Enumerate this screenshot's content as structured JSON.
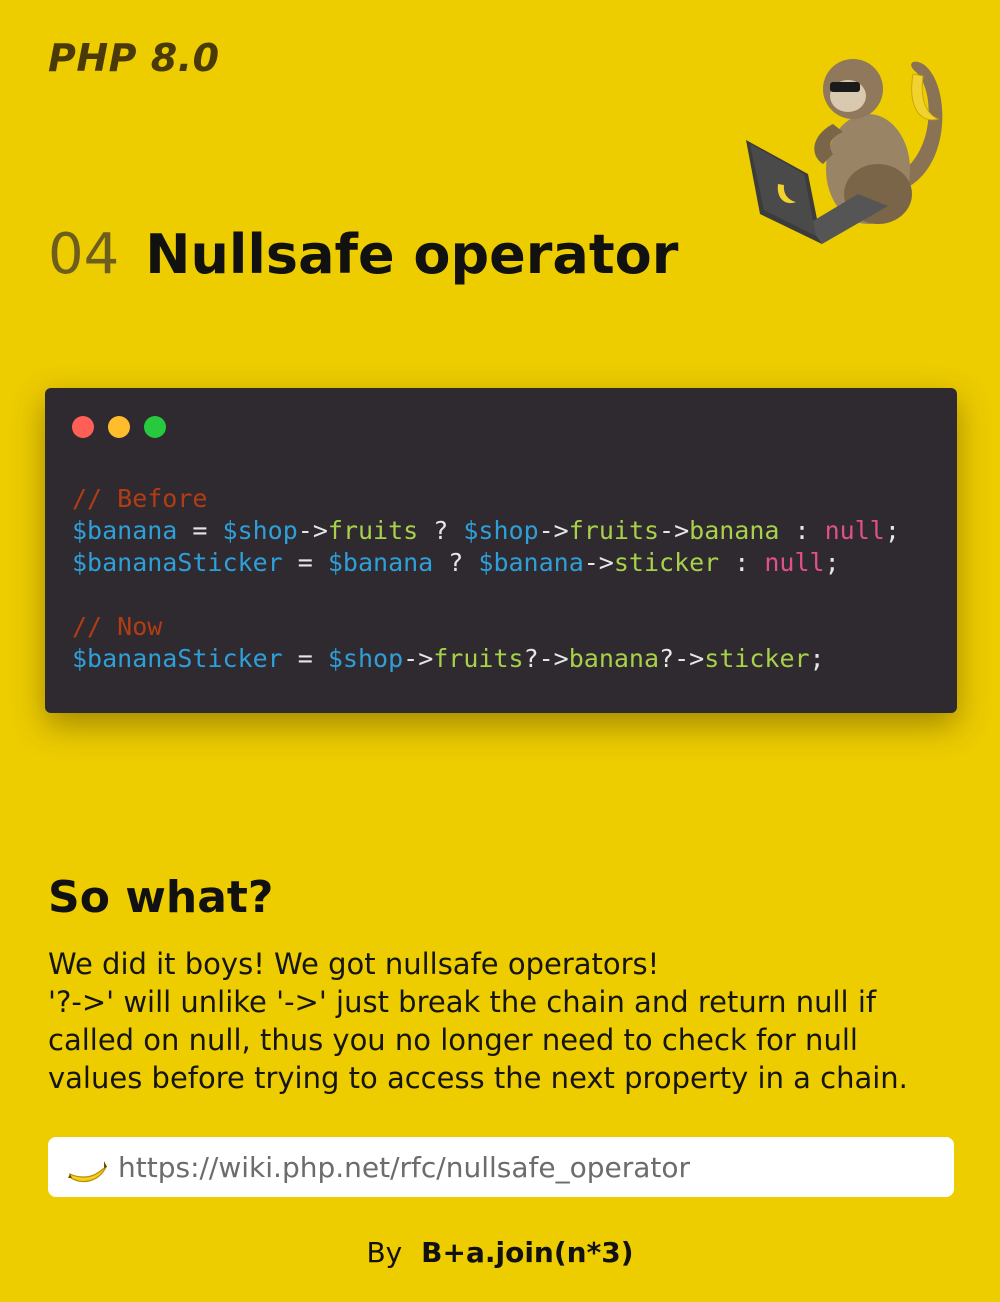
{
  "header": {
    "brand": "PHP 8.0",
    "number": "04",
    "title": "Nullsafe operator",
    "mascot_icon": "monkey-with-laptop-icon"
  },
  "code_window": {
    "dots": [
      "#ff5f56",
      "#ffbd2e",
      "#27c93f"
    ],
    "lines": [
      [
        {
          "t": "// Before",
          "k": "comment"
        }
      ],
      [
        {
          "t": "$banana",
          "k": "var"
        },
        {
          "t": " = ",
          "k": "op"
        },
        {
          "t": "$shop",
          "k": "var"
        },
        {
          "t": "->",
          "k": "op"
        },
        {
          "t": "fruits",
          "k": "prop"
        },
        {
          "t": " ? ",
          "k": "op"
        },
        {
          "t": "$shop",
          "k": "var"
        },
        {
          "t": "->",
          "k": "op"
        },
        {
          "t": "fruits",
          "k": "prop"
        },
        {
          "t": "->",
          "k": "op"
        },
        {
          "t": "banana",
          "k": "prop"
        },
        {
          "t": " : ",
          "k": "op"
        },
        {
          "t": "null",
          "k": "null"
        },
        {
          "t": ";",
          "k": "op"
        }
      ],
      [
        {
          "t": "$bananaSticker",
          "k": "var"
        },
        {
          "t": " = ",
          "k": "op"
        },
        {
          "t": "$banana",
          "k": "var"
        },
        {
          "t": " ? ",
          "k": "op"
        },
        {
          "t": "$banana",
          "k": "var"
        },
        {
          "t": "->",
          "k": "op"
        },
        {
          "t": "sticker",
          "k": "prop"
        },
        {
          "t": " : ",
          "k": "op"
        },
        {
          "t": "null",
          "k": "null"
        },
        {
          "t": ";",
          "k": "op"
        }
      ],
      [],
      [
        {
          "t": "// Now",
          "k": "comment"
        }
      ],
      [
        {
          "t": "$bananaSticker",
          "k": "var"
        },
        {
          "t": " = ",
          "k": "op"
        },
        {
          "t": "$shop",
          "k": "var"
        },
        {
          "t": "->",
          "k": "op"
        },
        {
          "t": "fruits",
          "k": "prop"
        },
        {
          "t": "?->",
          "k": "op"
        },
        {
          "t": "banana",
          "k": "prop"
        },
        {
          "t": "?->",
          "k": "op"
        },
        {
          "t": "sticker",
          "k": "prop"
        },
        {
          "t": ";",
          "k": "op"
        }
      ]
    ]
  },
  "explanation": {
    "heading": "So what?",
    "lines": [
      "We did it boys! We got nullsafe operators!",
      "'?->' will unlike '->' just break the chain and return null if",
      "called on null, thus you no longer need to check for null",
      "values before trying to access the next property in a chain."
    ]
  },
  "link": {
    "icon": "banana-icon",
    "url": "https://wiki.php.net/rfc/nullsafe_operator"
  },
  "footer": {
    "by": "By",
    "author": "B+a.join(n*3)"
  },
  "colors": {
    "background": "#edcc00",
    "code_bg": "#2f2930",
    "comment": "#b23d14",
    "variable": "#2f9fd8",
    "property": "#a8d14a",
    "null": "#e0508c"
  }
}
